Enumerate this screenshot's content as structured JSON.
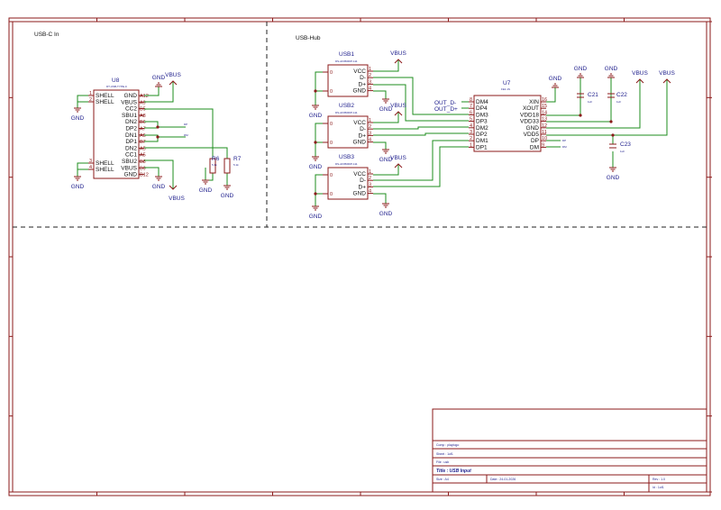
{
  "sections": {
    "left": "USB-C In",
    "right": "USB-Hub"
  },
  "u8": {
    "ref": "U8",
    "value": "DT-USB-TYPE-C",
    "left_pins": [
      {
        "num": "1",
        "name": "SHELL"
      },
      {
        "num": "2",
        "name": "SHELL"
      },
      {
        "num": "3",
        "name": "SHELL"
      },
      {
        "num": "4",
        "name": "SHELL"
      }
    ],
    "right_pins": [
      {
        "name": "GND",
        "pin": "A12"
      },
      {
        "name": "VBUS",
        "pin": "A9"
      },
      {
        "name": "CC2",
        "pin": "B5"
      },
      {
        "name": "SBU1",
        "pin": "A8"
      },
      {
        "name": "DN2",
        "pin": "B6"
      },
      {
        "name": "DP2",
        "pin": "A7"
      },
      {
        "name": "DN1",
        "pin": "A6"
      },
      {
        "name": "DP1",
        "pin": "B7"
      },
      {
        "name": "DN2",
        "pin": "A5"
      },
      {
        "name": "CC1",
        "pin": "A5"
      },
      {
        "name": "SBU2",
        "pin": "B8"
      },
      {
        "name": "VBUS",
        "pin": "B9"
      },
      {
        "name": "GND",
        "pin": "B12"
      }
    ]
  },
  "resistors": [
    {
      "ref": "R6",
      "value": "5.1k"
    },
    {
      "ref": "R7",
      "value": "5.1k"
    }
  ],
  "usb_ports": [
    {
      "ref": "USB1",
      "value": "DS-AF050DIP-111"
    },
    {
      "ref": "USB2",
      "value": "DS-AF050DIP-111"
    },
    {
      "ref": "USB3",
      "value": "DS-AF050DIP-111"
    }
  ],
  "usb_pins": [
    {
      "num": "1",
      "name": "VCC"
    },
    {
      "num": "2",
      "name": "D-"
    },
    {
      "num": "3",
      "name": "D+"
    },
    {
      "num": "4",
      "name": "GND"
    }
  ],
  "usb_shell_pin": "0",
  "u7": {
    "ref": "U7",
    "value": "FE1.1S",
    "left_pins": [
      {
        "num": "8",
        "name": "DM4"
      },
      {
        "num": "7",
        "name": "DP4"
      },
      {
        "num": "6",
        "name": "DM3"
      },
      {
        "num": "5",
        "name": "DP3"
      },
      {
        "num": "4",
        "name": "DM2"
      },
      {
        "num": "3",
        "name": "DP2"
      },
      {
        "num": "2",
        "name": "DM1"
      },
      {
        "num": "1",
        "name": "DP1"
      }
    ],
    "right_pins": [
      {
        "num": "16",
        "name": "XIN"
      },
      {
        "num": "15",
        "name": "XOUT"
      },
      {
        "num": "14",
        "name": "VDD18"
      },
      {
        "num": "13",
        "name": "VDD33"
      },
      {
        "num": "12",
        "name": "GND"
      },
      {
        "num": "11",
        "name": "VDD5"
      },
      {
        "num": "10",
        "name": "DP"
      },
      {
        "num": "9",
        "name": "DM"
      }
    ]
  },
  "caps": [
    {
      "ref": "C21",
      "value": "1uF"
    },
    {
      "ref": "C22",
      "value": "1uF"
    },
    {
      "ref": "C23",
      "value": "1uF"
    }
  ],
  "net_labels": {
    "out_dm": "OUT_D-",
    "out_dp": "OUT_D+",
    "dp_net": "DP",
    "dm_net": "DM"
  },
  "power": {
    "gnd": "GND",
    "vbus": "VBUS"
  },
  "title_block": {
    "company": "Comp : playlogo",
    "sheet": "Sheet : 1of1",
    "file": "File : usb",
    "title": "Title : USB Input",
    "size": "Size : A4",
    "date": "Date : 24-01-2026",
    "rev": "Rev : 1.0",
    "id": "Id : 1of1"
  },
  "colors": {
    "wire": "#1e8c1e",
    "component": "#8b1a1a",
    "text": "#1e1e8c",
    "border": "#8b1a1a",
    "divider": "#333333"
  }
}
